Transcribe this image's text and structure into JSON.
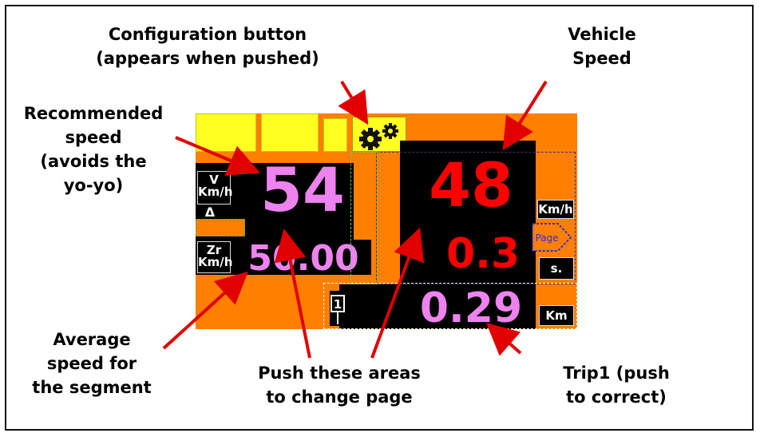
{
  "annotations": {
    "config": [
      "Configuration button",
      "(appears when pushed)"
    ],
    "vehicle_speed": [
      "Vehicle",
      "Speed"
    ],
    "recommended": [
      "Recommended",
      "speed",
      "(avoids the",
      "yo-yo)"
    ],
    "average": [
      "Average",
      "speed for",
      "the segment"
    ],
    "push_areas": [
      "Push these areas",
      "to change page"
    ],
    "trip1": [
      "Trip1 (push",
      "to correct)"
    ]
  },
  "dashboard": {
    "recommended_speed": "54",
    "average_speed": "50.00",
    "vehicle_speed": "48",
    "seconds_value": "0.3",
    "trip_value": "0.29",
    "unit_v_kmh": [
      "V",
      "Km/h"
    ],
    "unit_zr_kmh": [
      "Zr",
      "Km/h"
    ],
    "unit_kmh": "Km/h",
    "unit_s": "s.",
    "unit_km": "Km",
    "page_button_label": "Page",
    "trip_number": "1",
    "delta_symbol": "Δ"
  },
  "colors": {
    "orange": "#ff7f00",
    "yellow": "#ffff22",
    "pink": "#ee82ee",
    "red": "#ff0000",
    "black": "#000000"
  },
  "icons": [
    "gear-icon",
    "page-arrow-icon",
    "sign-icon"
  ]
}
